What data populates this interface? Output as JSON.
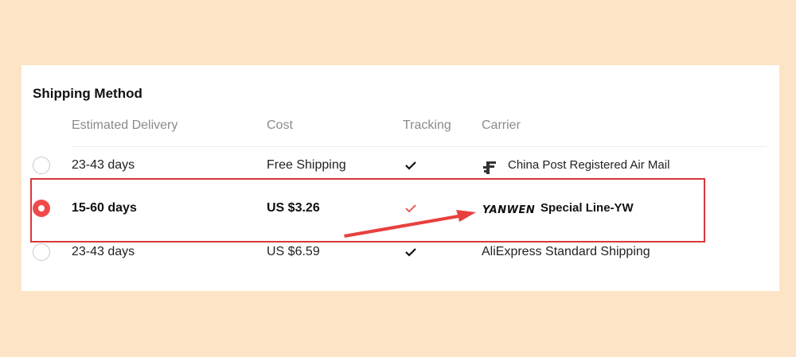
{
  "title": "Shipping Method",
  "headers": {
    "delivery": "Estimated Delivery",
    "cost": "Cost",
    "tracking": "Tracking",
    "carrier": "Carrier"
  },
  "rows": [
    {
      "delivery": "23-43 days",
      "cost": "Free Shipping",
      "tracking": true,
      "carrier_icon": "china-post-logo-icon",
      "carrier": "China Post Registered Air Mail",
      "selected": false
    },
    {
      "delivery": "15-60 days",
      "cost": "US $3.26",
      "tracking": true,
      "carrier_logo": "YANWEN",
      "carrier": "Special Line-YW",
      "selected": true
    },
    {
      "delivery": "23-43 days",
      "cost": "US $6.59",
      "tracking": true,
      "carrier": "AliExpress Standard Shipping",
      "selected": false
    }
  ],
  "colors": {
    "background": "#fde4c6",
    "accent": "#f04b4b",
    "highlight": "#d9363b",
    "check_selected": "#e0504f",
    "check_default": "#111111"
  },
  "icons": {
    "check": "check-icon",
    "arrow": "arrow-annotation"
  }
}
